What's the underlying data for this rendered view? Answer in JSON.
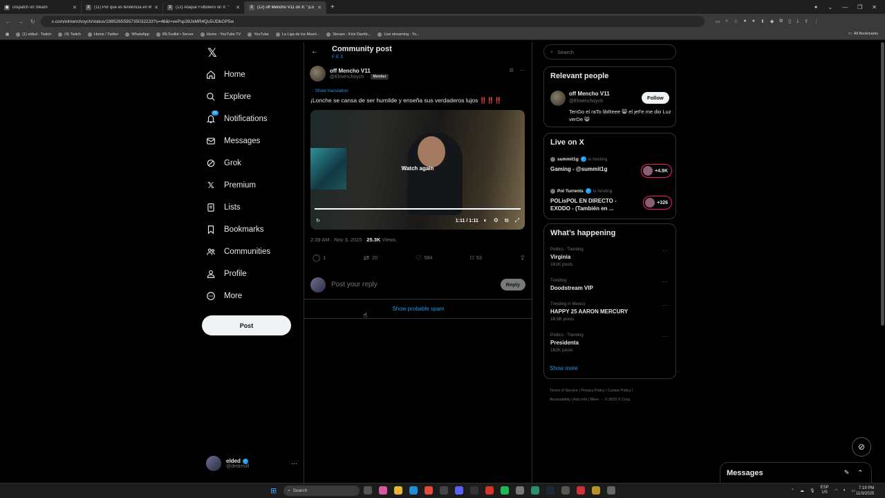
{
  "browser": {
    "tabs": [
      {
        "title": "Dispatch on Steam",
        "favicon": "steam-icon",
        "active": false
      },
      {
        "title": "(11) Por que es tendencia en M",
        "favicon": "x-icon",
        "active": false
      },
      {
        "title": "(12) Ataque Futbolero on X: \"",
        "favicon": "x-icon",
        "active": false
      },
      {
        "title": "(12) off Mencho V11 on X: \"¡Lo",
        "favicon": "x-icon",
        "active": true
      }
    ],
    "url": "x.com/elmenchoych/status/1985265595735032233?s=46&t=vePsp39JxMR4Qu5UDbOP5w",
    "bookmarks": [
      "(1) elded - Twitch",
      "(4) Twitch",
      "Home / Twitter",
      "WhatsApp",
      "IRLToolkit • Server",
      "Home - YouTube TV",
      "YouTube",
      "La Liga de los Muert...",
      "Stream - Kick Dashb...",
      "Live streaming - Yo..."
    ],
    "all_bookmarks": "All Bookmarks"
  },
  "sidebar": {
    "logo": "𝕏",
    "items": [
      {
        "label": "Home",
        "icon": "home-icon"
      },
      {
        "label": "Explore",
        "icon": "search-icon"
      },
      {
        "label": "Notifications",
        "icon": "bell-icon",
        "badge": "12"
      },
      {
        "label": "Messages",
        "icon": "mail-icon"
      },
      {
        "label": "Grok",
        "icon": "grok-icon"
      },
      {
        "label": "Premium",
        "icon": "x-icon"
      },
      {
        "label": "Lists",
        "icon": "list-icon"
      },
      {
        "label": "Bookmarks",
        "icon": "bookmark-icon"
      },
      {
        "label": "Communities",
        "icon": "people-icon"
      },
      {
        "label": "Profile",
        "icon": "person-icon"
      },
      {
        "label": "More",
        "icon": "more-circle-icon"
      }
    ],
    "post_button": "Post",
    "account": {
      "name": "elded",
      "handle": "@dedrevill"
    }
  },
  "main": {
    "header": {
      "title": "Community post",
      "subtitle": "FES"
    },
    "post": {
      "author_name": "off Mencho V11",
      "author_handle": "@Elmenchoych",
      "member_badge": "Member",
      "show_translation": "Show translation",
      "text": "¡Lonche se cansa de ser humilde y enseña sus verdaderos lujos",
      "text_emoji": "‼️‼️‼️",
      "video": {
        "overlay": "Watch again",
        "time": "1:11 / 1:11",
        "progress": 1.0
      },
      "time": "2:39 AM · Nov 3, 2025 · ",
      "views_count": "25.3K",
      "views_label": " Views",
      "replies": "1",
      "reposts": "20",
      "likes": "584",
      "bookmarks": "53"
    },
    "reply_placeholder": "Post your reply",
    "reply_button": "Reply",
    "spam_link": "Show probable spam"
  },
  "right": {
    "search_placeholder": "Search",
    "relevant": {
      "title": "Relevant people",
      "name": "off Mencho V11",
      "handle": "@Elmenchoych",
      "follow": "Follow",
      "bio": "TenGo el raTo libReee 😸 el jeFe me dio Luz verDe 😸"
    },
    "live": {
      "title": "Live on X",
      "items": [
        {
          "host": "summit1g",
          "hosting": "is hosting",
          "title": "Gaming - @summit1g",
          "count": "+4.9K"
        },
        {
          "host": "Pol Turrents",
          "hosting": "is hosting",
          "title": "POLisPOL EN DIRECTO - EXODO - (También en ...",
          "count": "+326"
        }
      ]
    },
    "happening": {
      "title": "What’s happening",
      "items": [
        {
          "meta": "Politics · Trending",
          "name": "Virginia",
          "posts": "161K posts"
        },
        {
          "meta": "Trending",
          "name": "Doodstream VIP",
          "posts": ""
        },
        {
          "meta": "Trending in Mexico",
          "name": "HAPPY 25 AARON MERCURY",
          "posts": "18.5K posts"
        },
        {
          "meta": "Politics · Trending",
          "name": "Presidenta",
          "posts": "162K posts"
        }
      ],
      "show_more": "Show more"
    },
    "footer": {
      "line1": "Terms of Service  |  Privacy Policy  |  Cookie Policy  |",
      "line2": "Accessibility  |  Ads info  |  More ···  © 2025 X Corp."
    }
  },
  "messages_drawer": "Messages",
  "taskbar": {
    "search": "Search",
    "lang": "ESP",
    "region": "US",
    "time": "7:19 PM",
    "date": "11/3/2025"
  },
  "colors": {
    "accent": "#1d9bf0",
    "background": "#000000",
    "text": "#e7e9ea",
    "muted": "#71767b",
    "live_ring": "#f91880"
  }
}
